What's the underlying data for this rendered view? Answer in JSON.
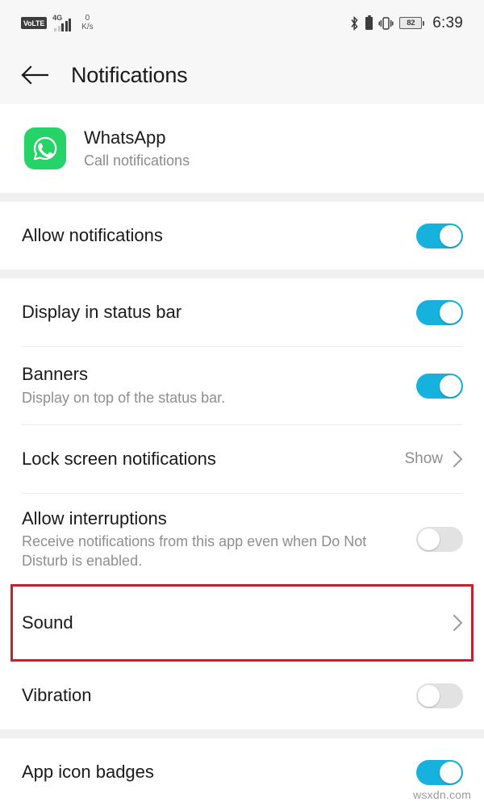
{
  "status_bar": {
    "volte_label": "VoLTE",
    "network_type": "4G",
    "net_speed_value": "0",
    "net_speed_unit": "K/s",
    "battery_percent": "82",
    "time": "6:39",
    "icons": [
      "volte-badge",
      "signal-bars-icon",
      "network-speed",
      "bluetooth-icon",
      "bluetooth-device-battery-icon",
      "vibrate-mode-icon",
      "battery-icon"
    ]
  },
  "titlebar": {
    "back_label": "back-arrow-icon",
    "title": "Notifications"
  },
  "app_header": {
    "icon_name": "whatsapp-icon",
    "icon_color": "#25D366",
    "name": "WhatsApp",
    "subtitle": "Call notifications"
  },
  "accent_color": "#17B1DD",
  "highlight_color": "#C8202E",
  "sections": [
    {
      "rows": [
        {
          "name": "allow-notifications",
          "title": "Allow notifications",
          "sub": null,
          "control": "toggle",
          "state": "on"
        }
      ]
    },
    {
      "rows": [
        {
          "name": "display-in-status-bar",
          "title": "Display in status bar",
          "sub": null,
          "control": "toggle",
          "state": "on"
        },
        {
          "name": "banners",
          "title": "Banners",
          "sub": "Display on top of the status bar.",
          "control": "toggle",
          "state": "on"
        },
        {
          "name": "lock-screen-notifications",
          "title": "Lock screen notifications",
          "sub": null,
          "control": "chevron",
          "value": "Show"
        },
        {
          "name": "allow-interruptions",
          "title": "Allow interruptions",
          "sub": "Receive notifications from this app even when Do Not Disturb is enabled.",
          "control": "toggle",
          "state": "off"
        },
        {
          "name": "sound",
          "title": "Sound",
          "sub": null,
          "control": "chevron",
          "value": "",
          "highlighted": true
        },
        {
          "name": "vibration",
          "title": "Vibration",
          "sub": null,
          "control": "toggle",
          "state": "off"
        }
      ]
    },
    {
      "rows": [
        {
          "name": "app-icon-badges",
          "title": "App icon badges",
          "sub": null,
          "control": "toggle",
          "state": "on"
        }
      ]
    }
  ],
  "watermark": "wsxdn.com"
}
